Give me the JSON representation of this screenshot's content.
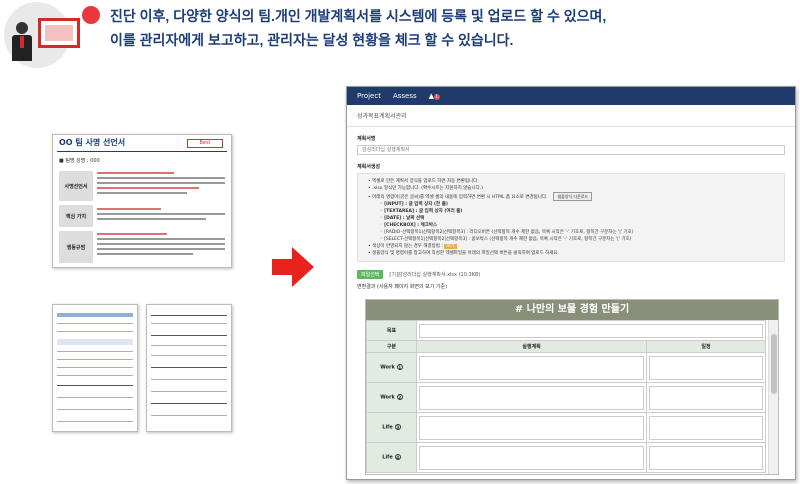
{
  "header": {
    "line1": "진단 이후, 다양한 양식의 팀.개인 개발계획서를 시스템에 등록 및 업로드 할 수 있으며,",
    "line2": "이를 관리자에게 보고하고, 관리자는 달성 현황을 체크 할 수 있습니다.",
    "accent": "#e8383d"
  },
  "doc1": {
    "title": "OO 팀 사명 선언서",
    "badge": "Best",
    "team": "■ 팀명 성명 : 000",
    "rows": [
      "사명선언서",
      "핵심 가치",
      "행동규범"
    ]
  },
  "app": {
    "nav": [
      "Project",
      "Assess"
    ],
    "bell_count": "1",
    "page_title": "성과목표계획서관리",
    "plan_name_label": "계획서명",
    "plan_name_value": "감성리더십 실행계획서",
    "plan_gen_label": "계획서생성",
    "guide": [
      "엑셀로 만든 계획서 양식을 업로드 하면 자동 변환됩니다.",
      ".xlsx 형식만 가능합니다. (확수시트는 지원하지 않습니다.)",
      "아래의 명령어(굵은 글씨)를 엑셀 셀의 내용에 입력하면 변환 시 HTML 폼 요소로 변경됩니다."
    ],
    "guide_btn": "샘플양식 다운로드",
    "guide_sub": [
      "[INPUT] : 글 입력 상자 (한 줄)",
      "[TEXTAREA] : 글 입력 상자 (여러 줄)",
      "[DATE] : 날짜 선택",
      "[CHECKBOX] : 체크박스",
      "[RADIO-선택항목1|선택항목2|선택항목3] : 라디오버튼 (선택항목 개수 제한 없음, 목록 시작은 '-' 기호로, 항목간 구분자는 '|' 기호)",
      "[SELECT-선택항목1|선택항목2|선택항목3] : 콤보박스 (선택항목 개수 제한 없음, 목록 시작은 '-' 기호로, 항목간 구분자는 '|' 기호)"
    ],
    "guide_tail_1": "색상이 반영되지 않는 경우 해결방법 :",
    "guide_tail_1_badge": "보기",
    "guide_tail_2": "생플양식 및 명령어를 참고하여 작성한 엑셀파일을 아래의 파일선택 버튼을 클릭하여 업로드 하세요.",
    "upload_btn": "파일선택",
    "upload_file": "[기]감성리더십 실행계획서.xlsx (10.3KB)",
    "result_label": "변환결과 (사용자 페이지 화면의 보기 기준)",
    "form_title": "# 나만의 보물 경험 만들기",
    "goal_label": "목표",
    "cols": [
      "구분",
      "실행계획",
      "일정"
    ],
    "rows": [
      "Work",
      "Work",
      "Life",
      "Life"
    ],
    "row_icons": [
      "1",
      "2",
      "3",
      "4"
    ]
  }
}
